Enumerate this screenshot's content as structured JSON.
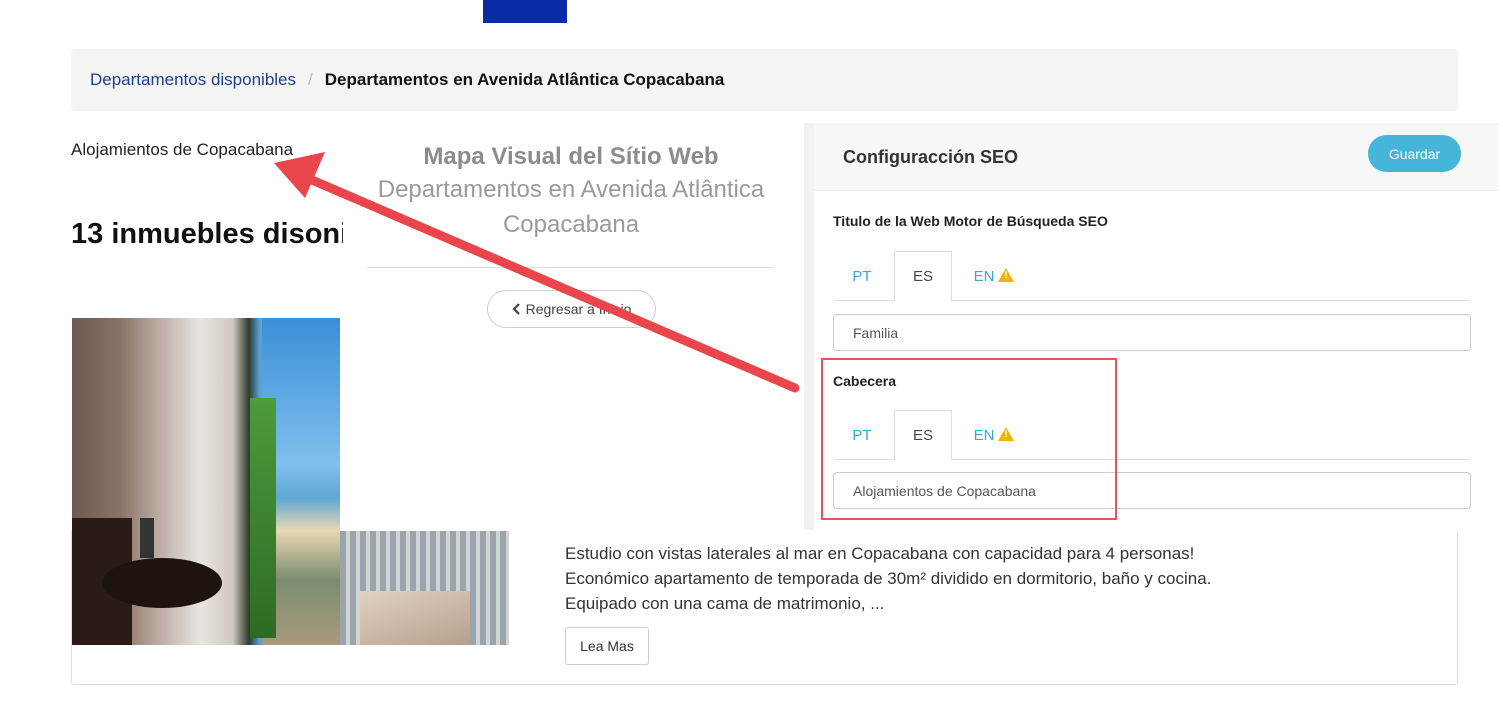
{
  "breadcrumb": {
    "link": "Departamentos disponibles",
    "separator": "/",
    "current": "Departamentos en Avenida Atlântica Copacabana"
  },
  "left": {
    "lodging_label": "Alojamientos de Copacabana",
    "count_heading": "13 inmuebles disoni"
  },
  "map": {
    "title": "Mapa Visual del Sítio Web",
    "subtitle": "Departamentos en Avenida Atlântica Copacabana",
    "back_button": "Regresar a Inicio",
    "back_icon": "chevron-left-icon"
  },
  "listing": {
    "description": "Estudio con vistas laterales al mar en Copacabana con capacidad para 4 personas! Económico apartamento de temporada de 30m² dividido en dormitorio, baño y cocina. Equipado con una cama de matrimonio, ...",
    "read_more": "Lea Mas"
  },
  "seo": {
    "title": "Configuracción SEO",
    "save_button": "Guardar",
    "save_color": "#45b6d9",
    "fields": [
      {
        "label": "Titulo de la Web Motor de Búsqueda SEO",
        "tabs": [
          "PT",
          "ES",
          "EN"
        ],
        "active_tab": "ES",
        "value": "Familia"
      },
      {
        "label": "Cabecera",
        "tabs": [
          "PT",
          "ES",
          "EN"
        ],
        "active_tab": "ES",
        "value": "Alojamientos de Copacabana"
      }
    ],
    "warning_icon": "warning-icon",
    "warning_color": "#f0b400"
  },
  "annotation": {
    "arrow_color": "#e8464a",
    "highlight_color": "#e0555a"
  }
}
